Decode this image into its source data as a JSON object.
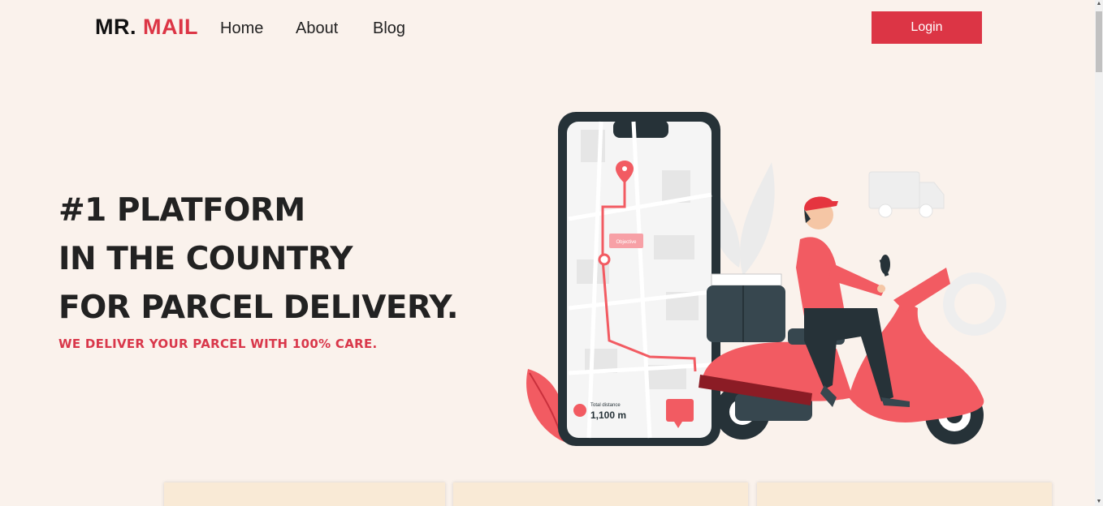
{
  "brand": {
    "part1": "MR.",
    "part2": "MAIL"
  },
  "nav": {
    "home": "Home",
    "about": "About",
    "blog": "Blog"
  },
  "login_label": "Login",
  "hero": {
    "line1": "#1 PLATFORM",
    "line2": "IN THE COUNTRY",
    "line3": "FOR PARCEL DELIVERY.",
    "subtitle": "WE DELIVER YOUR PARCEL WITH 100% CARE."
  },
  "illustration": {
    "map_tag": "Objective",
    "distance_label": "Total distance",
    "distance_value": "1,100 m"
  },
  "colors": {
    "accent": "#dc3545",
    "background": "#faf2ec",
    "card": "#f9ead6"
  }
}
